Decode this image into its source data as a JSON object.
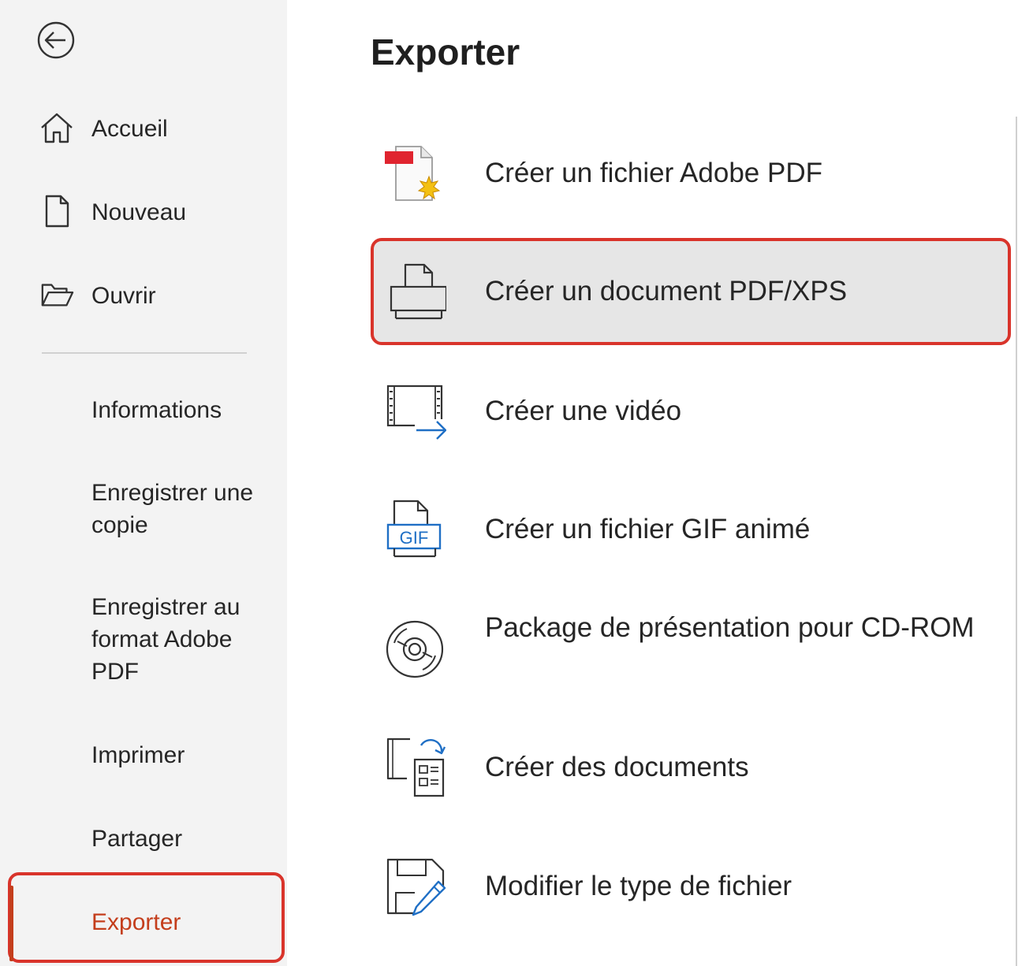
{
  "sidebar": {
    "back_label": "",
    "items": [
      {
        "label": "Accueil",
        "icon": "home-icon"
      },
      {
        "label": "Nouveau",
        "icon": "new-document-icon"
      },
      {
        "label": "Ouvrir",
        "icon": "folder-open-icon"
      },
      {
        "label": "Informations"
      },
      {
        "label": "Enregistrer une copie"
      },
      {
        "label": "Enregistrer au format Adobe PDF"
      },
      {
        "label": "Imprimer"
      },
      {
        "label": "Partager"
      },
      {
        "label": "Exporter",
        "selected": true
      }
    ],
    "accent_color": "#c43e1c",
    "highlight_color": "#d9342b"
  },
  "main": {
    "title": "Exporter",
    "options": [
      {
        "label": "Créer un fichier Adobe PDF",
        "icon": "adobe-pdf-icon"
      },
      {
        "label": "Créer un document PDF/XPS",
        "icon": "pdf-xps-icon",
        "selected": true
      },
      {
        "label": "Créer une vidéo",
        "icon": "video-icon"
      },
      {
        "label": "Créer un fichier GIF animé",
        "icon": "gif-icon",
        "icon_text": "GIF"
      },
      {
        "label": "Package de présentation pour CD-ROM",
        "icon": "cd-rom-icon"
      },
      {
        "label": "Créer des documents",
        "icon": "handouts-icon"
      },
      {
        "label": "Modifier le type de fichier",
        "icon": "change-file-type-icon"
      }
    ]
  }
}
